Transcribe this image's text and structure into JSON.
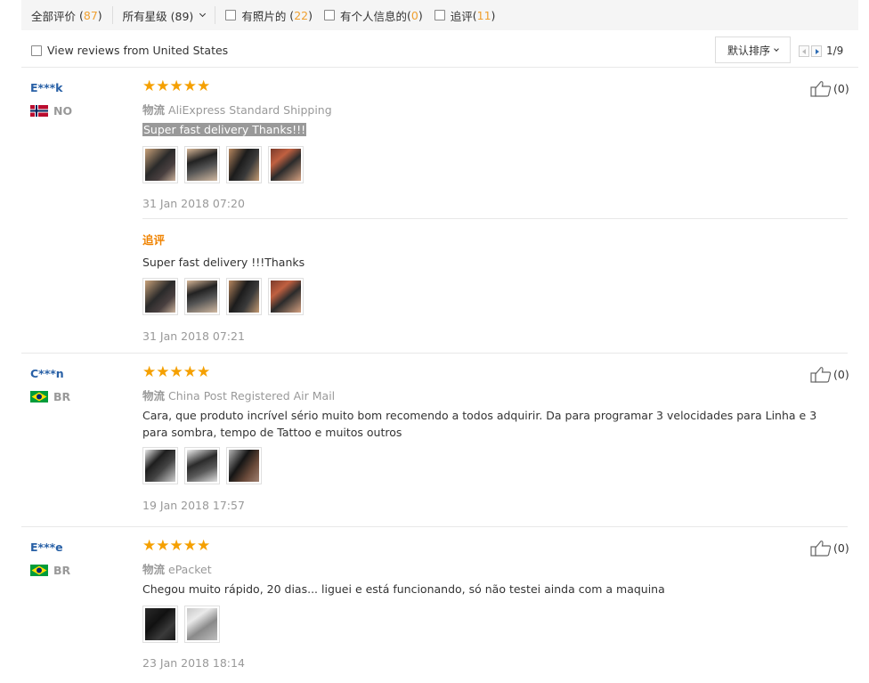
{
  "filters": {
    "all_label": "全部评价",
    "all_count": "87",
    "stars_label": "所有星级 (89)",
    "photos_label": "有照片的",
    "photos_count": "22",
    "info_label": "有个人信息的",
    "info_count": "0",
    "followup_label": "追评",
    "followup_count": "11"
  },
  "subbar": {
    "us_label": "View reviews from United States",
    "sort_label": "默认排序",
    "page_text": "1/9"
  },
  "ship_prefix": "物流",
  "followup_title": "追评",
  "colors": {
    "accent_orange": "#f0a030",
    "name_blue": "#2860a6",
    "star": "#f5a000"
  },
  "reviews": [
    {
      "name": "E***k",
      "country": "NO",
      "rating": 5,
      "stars": "★★★★★",
      "shipping": "AliExpress Standard Shipping",
      "text": "Super fast delivery Thanks!!!",
      "date": "31 Jan 2018 07:20",
      "likes": "(0)",
      "followup_text": "Super fast delivery !!!Thanks",
      "followup_date": "31 Jan 2018 07:21"
    },
    {
      "name": "C***n",
      "country": "BR",
      "rating": 5,
      "stars": "★★★★★",
      "shipping": "China Post Registered Air Mail",
      "text": "Cara, que produto incrível sério muito bom recomendo a todos adquirir. Da para programar 3 velocidades para Linha e 3 para sombra, tempo de Tattoo e muitos outros",
      "date": "19 Jan 2018 17:57",
      "likes": "(0)"
    },
    {
      "name": "E***e",
      "country": "BR",
      "rating": 5,
      "stars": "★★★★★",
      "shipping": "ePacket",
      "text": "Chegou muito rápido, 20 dias... liguei e está funcionando, só não testei ainda com a maquina",
      "date": "23 Jan 2018 18:14",
      "likes": "(0)"
    }
  ]
}
